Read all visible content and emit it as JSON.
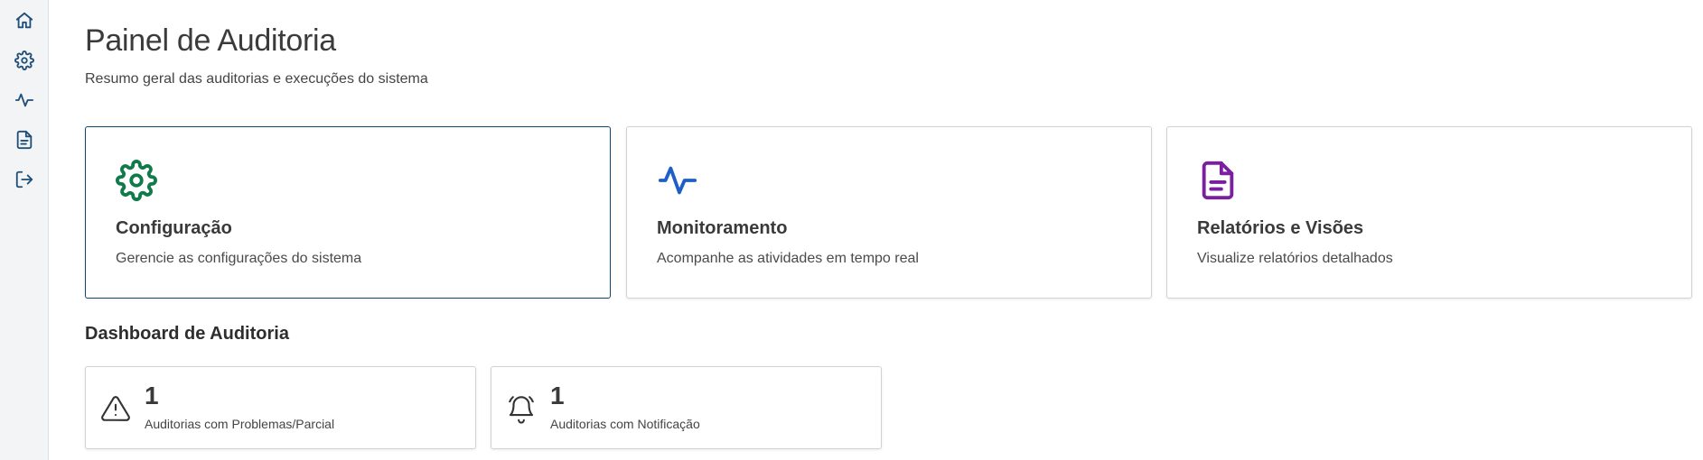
{
  "sidebar": {
    "items": [
      {
        "icon": "home-icon"
      },
      {
        "icon": "gear-icon"
      },
      {
        "icon": "activity-icon"
      },
      {
        "icon": "document-icon"
      },
      {
        "icon": "logout-icon"
      }
    ],
    "icon_color": "#1f4e79"
  },
  "header": {
    "title": "Painel de Auditoria",
    "subtitle": "Resumo geral das auditorias e execuções do sistema"
  },
  "cards": [
    {
      "icon": "gear-icon",
      "icon_color": "#0f7a4a",
      "title": "Configuração",
      "description": "Gerencie as configurações do sistema",
      "active": true
    },
    {
      "icon": "activity-icon",
      "icon_color": "#1e5fc7",
      "title": "Monitoramento",
      "description": "Acompanhe as atividades em tempo real",
      "active": false
    },
    {
      "icon": "document-icon",
      "icon_color": "#7a1fa2",
      "title": "Relatórios e Visões",
      "description": "Visualize relatórios detalhados",
      "active": false
    }
  ],
  "dashboard": {
    "title": "Dashboard de Auditoria",
    "stats": [
      {
        "icon": "warning-icon",
        "value": "1",
        "label": "Auditorias com Problemas/Parcial"
      },
      {
        "icon": "alarm-bell-icon",
        "value": "1",
        "label": "Auditorias com Notificação"
      }
    ]
  },
  "colors": {
    "active_border": "#14466b"
  }
}
